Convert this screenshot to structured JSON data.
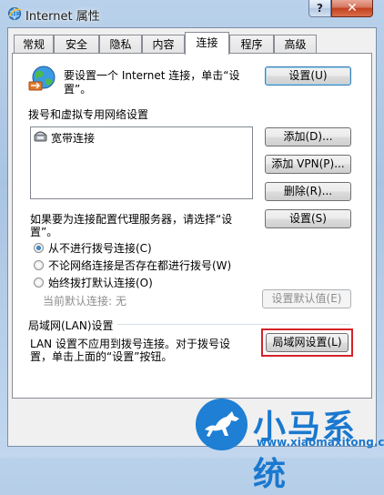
{
  "window": {
    "title": "Internet 属性",
    "help_label": "?",
    "close_label": "✕",
    "icon": "ie-globe-icon"
  },
  "tabs": [
    {
      "label": "常规"
    },
    {
      "label": "安全"
    },
    {
      "label": "隐私"
    },
    {
      "label": "内容"
    },
    {
      "label": "连接",
      "active": true
    },
    {
      "label": "程序"
    },
    {
      "label": "高级"
    }
  ],
  "setup": {
    "icon": "network-globe-icon",
    "text_line1": "要设置一个 Internet 连接，单击“设",
    "text_line2": "置”。",
    "button_label": "设置(U)"
  },
  "dialup": {
    "heading": "拨号和虚拟专用网络设置",
    "list_items": [
      {
        "label": "宽带连接",
        "icon": "dialup-connection-icon"
      }
    ],
    "add_label": "添加(D)...",
    "add_vpn_label": "添加 VPN(P)...",
    "remove_label": "删除(R)...",
    "proxy_text_line1": "如果要为连接配置代理服务器，请选择“设",
    "proxy_text_line2": "置”。",
    "settings_label": "设置(S)",
    "radio_options": [
      {
        "label": "从不进行拨号连接(C)",
        "checked": true
      },
      {
        "label": "不论网络连接是否存在都进行拨号(W)",
        "checked": false
      },
      {
        "label": "始终拨打默认连接(O)",
        "checked": false
      }
    ],
    "current_default_label": "当前默认连接:",
    "current_default_value": "无",
    "set_default_label": "设置默认值(E)"
  },
  "lan": {
    "heading": "局域网(LAN)设置",
    "text_line1": "LAN 设置不应用到拨号连接。对于拨号设",
    "text_line2": "置，单击上面的“设置”按钮。",
    "button_label": "局域网设置(L)"
  },
  "watermark": {
    "brand": "小马系统",
    "url": "www.xiaomaxitong.com"
  },
  "colors": {
    "highlight_border": "#d3232a",
    "watermark_blue": "#1a78cf"
  }
}
